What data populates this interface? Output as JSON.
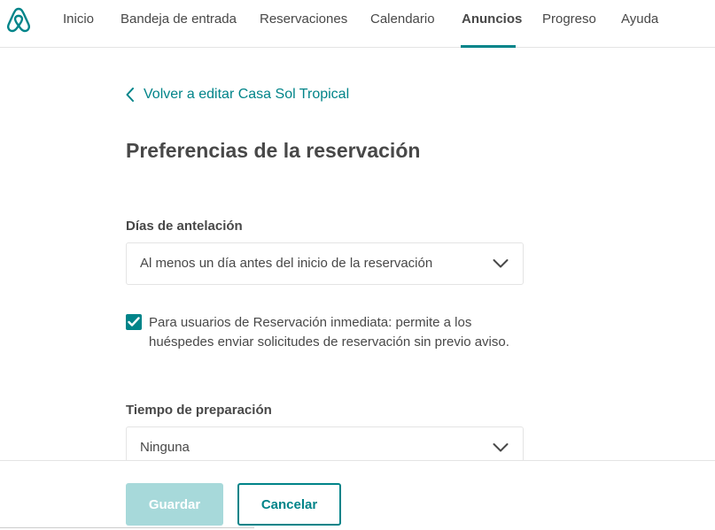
{
  "colors": {
    "accent": "#008489",
    "accent_disabled": "#a7d9da",
    "text": "#484848",
    "border": "#e4e4e4"
  },
  "nav": {
    "logo_icon": "airbnb-logo-icon",
    "items": [
      {
        "label": "Inicio",
        "active": false
      },
      {
        "label": "Bandeja de entrada",
        "active": false
      },
      {
        "label": "Reservaciones",
        "active": false
      },
      {
        "label": "Calendario",
        "active": false
      },
      {
        "label": "Anuncios",
        "active": true
      },
      {
        "label": "Progreso",
        "active": false
      },
      {
        "label": "Ayuda",
        "active": false
      }
    ]
  },
  "back_link": {
    "icon": "chevron-left-icon",
    "label": "Volver a editar Casa Sol Tropical"
  },
  "page_title": "Preferencias de la reservación",
  "advance_notice": {
    "label": "Días de antelación",
    "value": "Al menos un día antes del inicio de la reservación",
    "icon": "chevron-down-icon"
  },
  "instant_book_checkbox": {
    "checked": true,
    "label": "Para usuarios de Reservación inmediata: permite a los huéspedes enviar solicitudes de reservación sin previo aviso."
  },
  "preparation_time": {
    "label": "Tiempo de preparación",
    "value": "Ninguna",
    "icon": "chevron-down-icon"
  },
  "footer": {
    "save_label": "Guardar",
    "cancel_label": "Cancelar"
  }
}
